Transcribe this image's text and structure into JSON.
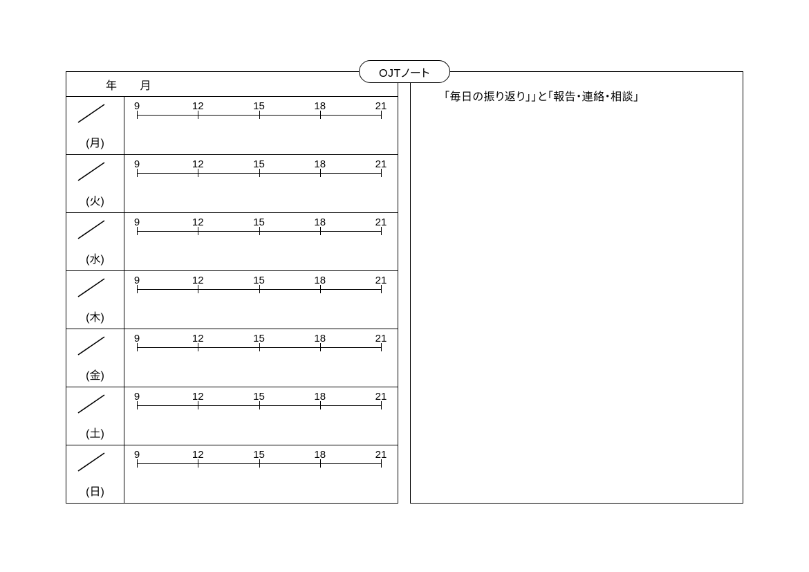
{
  "title": "OJTノート",
  "date_header": {
    "year_unit": "年",
    "month_unit": "月"
  },
  "time_ticks": [
    "9",
    "12",
    "15",
    "18",
    "21"
  ],
  "days": [
    {
      "label": "(月)"
    },
    {
      "label": "(火)"
    },
    {
      "label": "(水)"
    },
    {
      "label": "(木)"
    },
    {
      "label": "(金)"
    },
    {
      "label": "(土)"
    },
    {
      "label": "(日)"
    }
  ],
  "right_heading": "「毎日の振り返り」」と「報告・連絡・相談」"
}
